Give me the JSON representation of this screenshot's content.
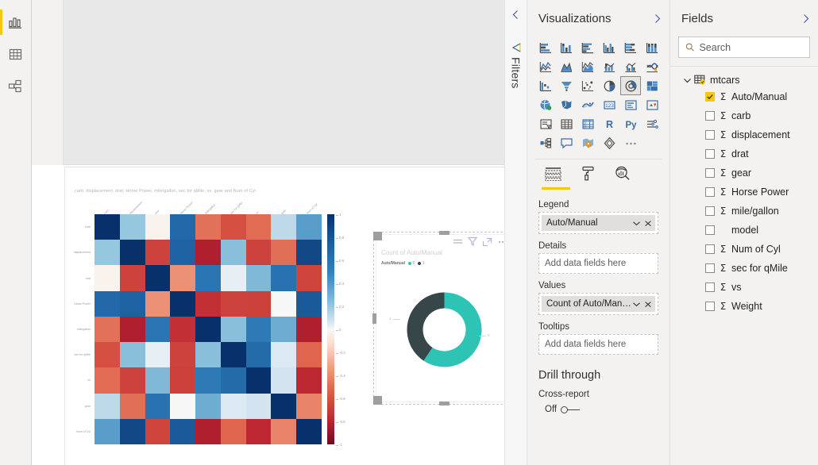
{
  "nav": {
    "items": [
      {
        "name": "report-view",
        "icon": "bar-chart-icon",
        "active": true
      },
      {
        "name": "data-view",
        "icon": "table-icon",
        "active": false
      },
      {
        "name": "model-view",
        "icon": "relationships-icon",
        "active": false
      }
    ]
  },
  "filters_pane": {
    "title": "Filters",
    "collapse_icon": "chevron-left-icon",
    "funnel_icon": "funnel-icon"
  },
  "visualizations": {
    "title": "Visualizations",
    "expand_icon": "chevron-right-icon",
    "collapse_icon": "chevron-left-icon",
    "icons": [
      "stacked-bar-chart",
      "stacked-column-chart",
      "clustered-bar-chart",
      "clustered-column-chart",
      "100-stacked-bar-chart",
      "100-stacked-column-chart",
      "line-chart",
      "area-chart",
      "stacked-area-chart",
      "line-and-stacked-column-chart",
      "line-and-clustered-column-chart",
      "ribbon-chart",
      "waterfall-chart",
      "funnel-chart",
      "scatter-chart",
      "pie-chart",
      "donut-chart",
      "treemap",
      "map",
      "filled-map",
      "arcgis-map",
      "card",
      "multi-row-card",
      "kpi",
      "slicer",
      "table",
      "matrix",
      "r-script-visual",
      "python-visual",
      "key-influencers",
      "decomposition-tree",
      "q-and-a",
      "azure-map",
      "paginated-report",
      "more-options"
    ],
    "selected_icon": "donut-chart",
    "well_tabs": [
      {
        "name": "fields-tab",
        "icon": "fields-icon",
        "active": true
      },
      {
        "name": "format-tab",
        "icon": "paint-roller-icon",
        "active": false
      },
      {
        "name": "analytics-tab",
        "icon": "magnifier-chart-icon",
        "active": false
      }
    ],
    "wells": [
      {
        "label": "Legend",
        "chips": [
          {
            "text": "Auto/Manual",
            "dropdown_icon": "chevron-down-icon",
            "remove_icon": "close-icon"
          }
        ],
        "placeholder": ""
      },
      {
        "label": "Details",
        "chips": [],
        "placeholder": "Add data fields here"
      },
      {
        "label": "Values",
        "chips": [
          {
            "text": "Count of Auto/Manual",
            "dropdown_icon": "chevron-down-icon",
            "remove_icon": "close-icon"
          }
        ],
        "placeholder": ""
      },
      {
        "label": "Tooltips",
        "chips": [],
        "placeholder": "Add data fields here"
      }
    ],
    "drill_through": {
      "heading": "Drill through",
      "cross_report_label": "Cross-report",
      "toggle_state_label": "Off",
      "toggle_on": false
    }
  },
  "fields": {
    "title": "Fields",
    "expand_icon": "chevron-right-icon",
    "search": {
      "placeholder": "Search",
      "value": "",
      "icon": "search-icon"
    },
    "table": {
      "name": "mtcars",
      "expanded": true,
      "expand_icon": "chevron-down-icon",
      "table_icon": "table-icon"
    },
    "items": [
      {
        "label": "Auto/Manual",
        "checked": true,
        "aggregatable": true
      },
      {
        "label": "carb",
        "checked": false,
        "aggregatable": true
      },
      {
        "label": "displacement",
        "checked": false,
        "aggregatable": true
      },
      {
        "label": "drat",
        "checked": false,
        "aggregatable": true
      },
      {
        "label": "gear",
        "checked": false,
        "aggregatable": true
      },
      {
        "label": "Horse Power",
        "checked": false,
        "aggregatable": true
      },
      {
        "label": "mile/gallon",
        "checked": false,
        "aggregatable": true
      },
      {
        "label": "model",
        "checked": false,
        "aggregatable": false
      },
      {
        "label": "Num of Cyl",
        "checked": false,
        "aggregatable": true
      },
      {
        "label": "sec for qMile",
        "checked": false,
        "aggregatable": true
      },
      {
        "label": "vs",
        "checked": false,
        "aggregatable": true
      },
      {
        "label": "Weight",
        "checked": false,
        "aggregatable": true
      }
    ]
  },
  "canvas": {
    "donut_visual": {
      "header_icons": [
        "filter-list-icon",
        "funnel-icon",
        "focus-mode-icon",
        "more-options-icon"
      ],
      "selected": true
    }
  },
  "chart_data": [
    {
      "type": "heatmap",
      "title": "carb, displacement, drat, Horse Power, mile/gallon, sec for qMile, vs, gear and Num of Cyl",
      "xlabel": "",
      "ylabel": "",
      "x_categories": [
        "carb",
        "displacement",
        "drat",
        "Horse Power",
        "mile/gallon",
        "sec for qMile",
        "vs",
        "gear",
        "Num of Cyl"
      ],
      "y_categories": [
        "carb",
        "displacement",
        "drat",
        "Horse Power",
        "mile/gallon",
        "sec for qMile",
        "vs",
        "gear",
        "Num of Cyl"
      ],
      "colorbar": {
        "ticks": [
          "1",
          "0.8",
          "0.6",
          "0.4",
          "0.2",
          "0",
          "-0.2",
          "-0.4",
          "-0.6",
          "-0.8",
          "-1"
        ],
        "min": -1,
        "max": 1,
        "low_color": "#67001f",
        "mid_color": "#f7f7f7",
        "high_color": "#08306b"
      },
      "values": [
        [
          1.0,
          0.39,
          -0.09,
          0.75,
          -0.55,
          -0.66,
          -0.57,
          0.27,
          0.53
        ],
        [
          0.39,
          1.0,
          -0.71,
          0.79,
          -0.85,
          0.42,
          -0.71,
          -0.56,
          0.9
        ],
        [
          -0.09,
          -0.71,
          1.0,
          -0.45,
          0.68,
          0.09,
          0.44,
          0.7,
          -0.7
        ],
        [
          0.75,
          0.79,
          -0.45,
          1.0,
          -0.78,
          -0.71,
          -0.72,
          0.0,
          0.83
        ],
        [
          -0.55,
          -0.85,
          0.68,
          -0.78,
          1.0,
          0.42,
          0.66,
          0.48,
          -0.85
        ],
        [
          -0.66,
          0.42,
          0.09,
          -0.71,
          0.42,
          1.0,
          0.74,
          0.17,
          -0.59
        ],
        [
          -0.57,
          -0.71,
          0.44,
          -0.72,
          0.66,
          0.74,
          1.0,
          0.21,
          -0.81
        ],
        [
          0.27,
          -0.56,
          0.7,
          0.0,
          0.48,
          0.17,
          0.21,
          1.0,
          -0.49
        ],
        [
          0.53,
          0.9,
          -0.7,
          0.83,
          -0.85,
          -0.59,
          -0.81,
          -0.49,
          1.0
        ]
      ]
    },
    {
      "type": "pie",
      "subtype": "donut",
      "title": "Count of Auto/Manual",
      "legend_title": "Auto/Manual",
      "legend_position": "top",
      "labels": [
        "0",
        "1"
      ],
      "values": [
        19,
        13
      ],
      "colors": [
        "#2dc4b6",
        "#374649"
      ],
      "data_labels": [
        "0",
        "1"
      ]
    }
  ]
}
